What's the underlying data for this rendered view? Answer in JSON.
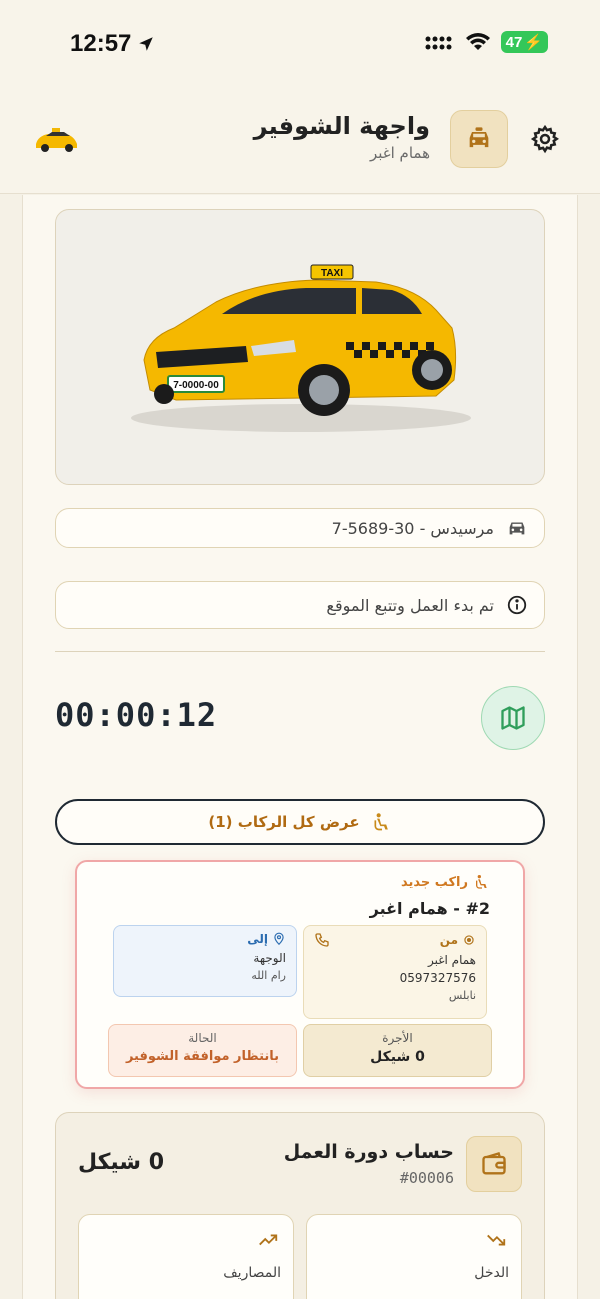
{
  "status_bar": {
    "time": "12:57",
    "battery": "47"
  },
  "header": {
    "title": "واجهة الشوفير",
    "subtitle": "همام اغبر"
  },
  "car_plate_row": {
    "text": "مرسيدس - 30-5689-7"
  },
  "car_image": {
    "roof_sign": "TAXI",
    "plate": "7-0000-00"
  },
  "status_row": {
    "text": "تم بدء العمل وتتبع الموقع"
  },
  "timer": {
    "value": "00:00:12"
  },
  "all_riders_button": {
    "label": "عرض كل الركاب (1)"
  },
  "rider_card": {
    "tag": "راكب جديد",
    "title": "#2 - همام اغبر",
    "from": {
      "label": "من",
      "name": "همام اغبر",
      "phone": "0597327576",
      "city": "نابلس"
    },
    "to": {
      "label": "إلى",
      "destination": "الوجهة",
      "city": "رام الله"
    },
    "fare": {
      "label": "الأجرة",
      "value": "0 شيكل"
    },
    "status": {
      "label": "الحالة",
      "value": "بانتظار موافقة الشوفير"
    }
  },
  "shift_summary": {
    "title": "حساب دورة العمل",
    "id": "#00006",
    "total": "0 شيكل",
    "income_label": "الدخل",
    "expenses_label": "المصاريف"
  },
  "colors": {
    "accent": "#c88a1a",
    "map_green": "#2f9e5b",
    "alert_red": "#f0a7a7"
  }
}
